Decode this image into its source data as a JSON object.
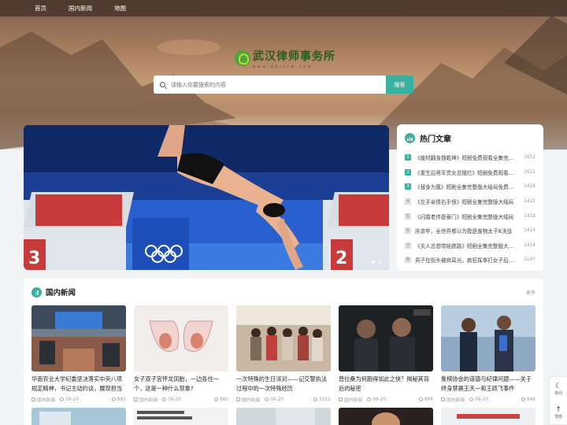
{
  "nav": {
    "items": [
      "首页",
      "国内新闻",
      "地图"
    ]
  },
  "logo": {
    "title": "武汉律师事务所",
    "subtitle": "www.whlssw.com"
  },
  "search": {
    "placeholder": "请输入你要搜索的内容",
    "button": "搜索"
  },
  "hot": {
    "title": "热门文章",
    "items": [
      {
        "rank": "1",
        "text": "《废材翻身翘乾坤》短剧免费观看全集完整版",
        "num": "1652"
      },
      {
        "rank": "2",
        "text": "《重生后将军贵女总摆烂》短剧免费观看全集",
        "num": "1621"
      },
      {
        "rank": "3",
        "text": "《替身为凰》短剧全集完整版大结局免费观看",
        "num": "1424"
      },
      {
        "rank": "4",
        "text": "《左手亲情右手恨》短剧全集完整版大结局",
        "num": "1422"
      },
      {
        "rank": "5",
        "text": "《闪婚老伴是豪门》短剧全集完整版大结局",
        "num": "1418"
      },
      {
        "rank": "6",
        "text": "庆余年，全世界都以为我是废物太子8决战",
        "num": "1414"
      },
      {
        "rank": "7",
        "text": "《夫人总想带娃跑路》短剧全集完整版大结局",
        "num": "1414"
      },
      {
        "rank": "8",
        "text": "男子在街头被商耳光，疯狂挥拳打女子后逃跑",
        "num": "1197"
      }
    ]
  },
  "news": {
    "title": "国内新闻",
    "more": "更多",
    "cards": [
      {
        "title": "华南农业大学纪委坚决落实中央八项规定精神，书记主动约谈，展现担当",
        "cat": "国内新闻",
        "date": "09-20",
        "views": "981"
      },
      {
        "title": "女子双子宫怀龙凤胎，一边各住一个，这是一种什么现象?",
        "cat": "国内新闻",
        "date": "09-20",
        "views": "982"
      },
      {
        "title": "一次特殊的生日派对——记交警执法过程中的一次特殊经历",
        "cat": "国内新闻",
        "date": "09-20",
        "views": "1012"
      },
      {
        "title": "普拉桑为何跑得如此之快？揭秘其背后的秘密",
        "cat": "国内新闻",
        "date": "09-20",
        "views": "984"
      },
      {
        "title": "象棋协会的道德与纪律问题——关于终身禁赛王天一和王跃飞事件",
        "cat": "国内新闻",
        "date": "09-20",
        "views": "946"
      }
    ]
  },
  "tools": {
    "theme": "夜间",
    "top": "顶部"
  },
  "colors": {
    "accent": "#3ab0a1"
  }
}
